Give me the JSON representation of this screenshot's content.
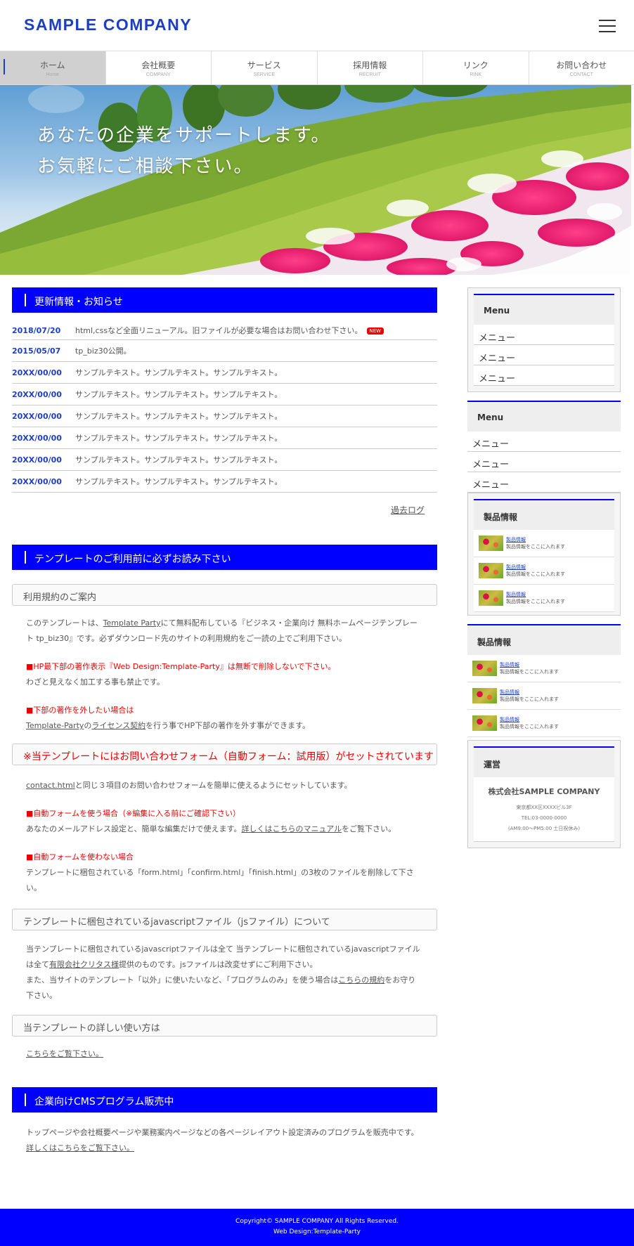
{
  "header": {
    "logo": "SAMPLE COMPANY"
  },
  "nav": [
    {
      "jp": "ホーム",
      "en": "Home"
    },
    {
      "jp": "会社概要",
      "en": "COMPANY"
    },
    {
      "jp": "サービス",
      "en": "SERVICE"
    },
    {
      "jp": "採用情報",
      "en": "RECRUIT"
    },
    {
      "jp": "リンク",
      "en": "RINK"
    },
    {
      "jp": "お問い合わせ",
      "en": "CONTACT"
    }
  ],
  "hero": {
    "line1": "あなたの企業をサポートします。",
    "line2": "お気軽にご相談下さい。"
  },
  "news": {
    "title": "更新情報・お知らせ",
    "items": [
      {
        "date": "2018/07/20",
        "text": "html,cssなど全面リニューアル。旧ファイルが必要な場合はお問い合わせ下さい。",
        "badge": "NEW"
      },
      {
        "date": "2015/05/07",
        "text": "tp_biz30公開。"
      },
      {
        "date": "20XX/00/00",
        "text": "サンプルテキスト。サンプルテキスト。サンプルテキスト。"
      },
      {
        "date": "20XX/00/00",
        "text": "サンプルテキスト。サンプルテキスト。サンプルテキスト。"
      },
      {
        "date": "20XX/00/00",
        "text": "サンプルテキスト。サンプルテキスト。サンプルテキスト。"
      },
      {
        "date": "20XX/00/00",
        "text": "サンプルテキスト。サンプルテキスト。サンプルテキスト。"
      },
      {
        "date": "20XX/00/00",
        "text": "サンプルテキスト。サンプルテキスト。サンプルテキスト。"
      },
      {
        "date": "20XX/00/00",
        "text": "サンプルテキスト。サンプルテキスト。サンプルテキスト。"
      }
    ],
    "pastlog": "過去ログ"
  },
  "notice": {
    "title": "テンプレートのご利用前に必ずお読み下さい",
    "h_terms": "利用規約のご案内",
    "p1a": "このテンプレートは、",
    "p1link": "Template Party",
    "p1b": "にて無料配布している『ビジネス・企業向け 無料ホームページテンプレート tp_biz30』です。必ずダウンロード先のサイトの利用規約をご一読の上でご利用下さい。",
    "r1": "■HP最下部の著作表示『Web Design:Template-Party』は無断で削除しないで下さい。",
    "p2": "わざと見えなく加工する事も禁止です。",
    "r2": "■下部の著作を外したい場合は",
    "p3link1": "Template-Party",
    "p3a": "の",
    "p3link2": "ライセンス契約",
    "p3b": "を行う事でHP下部の著作を外す事ができます。",
    "h_form": "※当テンプレートにはお問い合わせフォーム（自動フォーム：試用版）がセットされています",
    "p4link": "contact.html",
    "p4": "と同じ３項目のお問い合わせフォームを簡単に使えるようにセットしています。",
    "r3": "■自動フォームを使う場合（※編集に入る前にご確認下さい）",
    "p5a": "あなたのメールアドレス設定と、簡単な編集だけで使えます。",
    "p5link": "詳しくはこちらのマニュアル",
    "p5b": "をご覧下さい。",
    "r4": "■自動フォームを使わない場合",
    "p6": "テンプレートに梱包されている「form.html」「confirm.html」「finish.html」の3枚のファイルを削除して下さい。",
    "h_js": "テンプレートに梱包されているjavascriptファイル（jsファイル）について",
    "p7a": "当テンプレートに梱包されているjavascriptファイルは全て 当テンプレートに梱包されているjavascriptファイルは全て",
    "p7link": "有限会社クリタス様",
    "p7b": "提供のものです。jsファイルは改変せずにご利用下さい。",
    "p8a": "また、当サイトのテンプレート「以外」に使いたいなど、「プログラムのみ」を使う場合は",
    "p8link": "こちらの規約",
    "p8b": "をお守り下さい。",
    "h_usage": "当テンプレートの詳しい使い方は",
    "p9link": "こちらをご覧下さい。"
  },
  "cms": {
    "title": "企業向けCMSプログラム販売中",
    "p": "トップページや会社概要ページや業務案内ページなどの各ページレイアウト設定済みのプログラムを販売中です。",
    "link": "詳しくはこちらをご覧下さい。"
  },
  "side": {
    "menu1": {
      "title": "Menu",
      "items": [
        "メニュー",
        "メニュー",
        "メニュー"
      ]
    },
    "menu2": {
      "title": "Menu",
      "items": [
        "メニュー",
        "メニュー",
        "メニュー"
      ]
    },
    "prod1": {
      "title": "製品情報",
      "items": [
        {
          "t1": "製品情報",
          "t2": "製品情報をここに入れます"
        },
        {
          "t1": "製品情報",
          "t2": "製品情報をここに入れます"
        },
        {
          "t1": "製品情報",
          "t2": "製品情報をここに入れます"
        }
      ]
    },
    "prod2": {
      "title": "製品情報",
      "items": [
        {
          "t1": "製品情報",
          "t2": "製品情報をここに入れます"
        },
        {
          "t1": "製品情報",
          "t2": "製品情報をここに入れます"
        },
        {
          "t1": "製品情報",
          "t2": "製品情報をここに入れます"
        }
      ]
    },
    "unei": {
      "title": "運営",
      "name": "株式会社SAMPLE COMPANY",
      "addr": "東京都XX区XXXXビル3F",
      "tel": "TEL:03-0000-0000",
      "hours": "(AM9:00〜PM5:00 土日祝休み)"
    }
  },
  "footer": {
    "copy": "Copyright© SAMPLE COMPANY All Rights Reserved.",
    "credit": "Web Design:Template-Party"
  }
}
